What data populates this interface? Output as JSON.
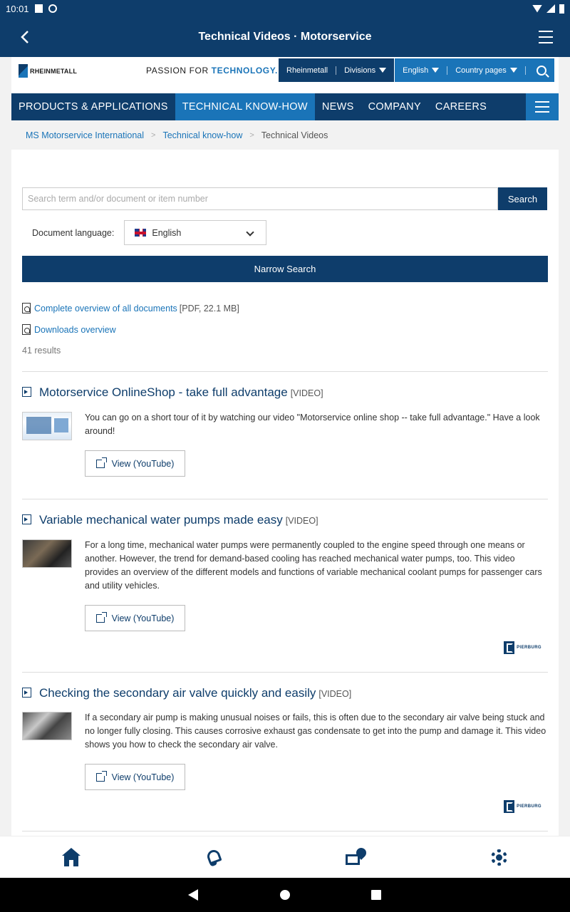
{
  "status_bar": {
    "time": "10:01"
  },
  "app_bar": {
    "title": "Technical Videos · Motorservice"
  },
  "site": {
    "logo_text": "RHEINMETALL",
    "slogan_a": "PASSION FOR ",
    "slogan_b": "TECHNOLOGY.",
    "topnav": {
      "rheinmetall": "Rheinmetall",
      "divisions": "Divisions",
      "language": "English",
      "country_pages": "Country pages"
    },
    "mainnav": [
      "PRODUCTS & APPLICATIONS",
      "TECHNICAL KNOW-HOW",
      "NEWS",
      "COMPANY",
      "CAREERS"
    ],
    "mainnav_active_index": 1,
    "breadcrumb": [
      "MS Motorservice International",
      "Technical know-how",
      "Technical Videos"
    ]
  },
  "search": {
    "placeholder": "Search term and/or document or item number",
    "button": "Search",
    "language_label": "Document language:",
    "language_value": "English",
    "narrow_button": "Narrow Search"
  },
  "documents": [
    {
      "link": "Complete overview of all documents",
      "meta": "[PDF, 22.1 MB]"
    },
    {
      "link": "Downloads overview",
      "meta": ""
    }
  ],
  "results_count": "41 results",
  "items": [
    {
      "title": "Motorservice OnlineShop - take full advantage",
      "tag": "[VIDEO]",
      "description": "You can go on a short tour of it by watching our video \"Motorservice online shop -- take full advantage.\" Have a look around!",
      "button": "View (YouTube)",
      "brand": ""
    },
    {
      "title": "Variable mechanical water pumps made easy",
      "tag": "[VIDEO]",
      "description": "For a long time, mechanical water pumps were permanently coupled to the engine speed through one means or another. However, the trend for demand-based cooling has reached mechanical water pumps, too. This video provides an overview of the different models and functions of variable mechanical coolant pumps for passenger cars and utility vehicles.",
      "button": "View (YouTube)",
      "brand": "PIERBURG"
    },
    {
      "title": "Checking the secondary air valve quickly and easily",
      "tag": "[VIDEO]",
      "description": "If a secondary air pump is making unusual noises or fails, this is often due to the secondary air valve being stuck and no longer fully closing. This causes corrosive exhaust gas condensate to get into the pump and damage it. This video shows you how to check the secondary air valve.",
      "button": "View (YouTube)",
      "brand": "PIERBURG"
    }
  ],
  "bottom_nav": [
    "home-icon",
    "bell-icon",
    "mail-location-icon",
    "gear-icon"
  ],
  "colors": {
    "primary": "#0e3d6b",
    "accent": "#1a74b8"
  }
}
